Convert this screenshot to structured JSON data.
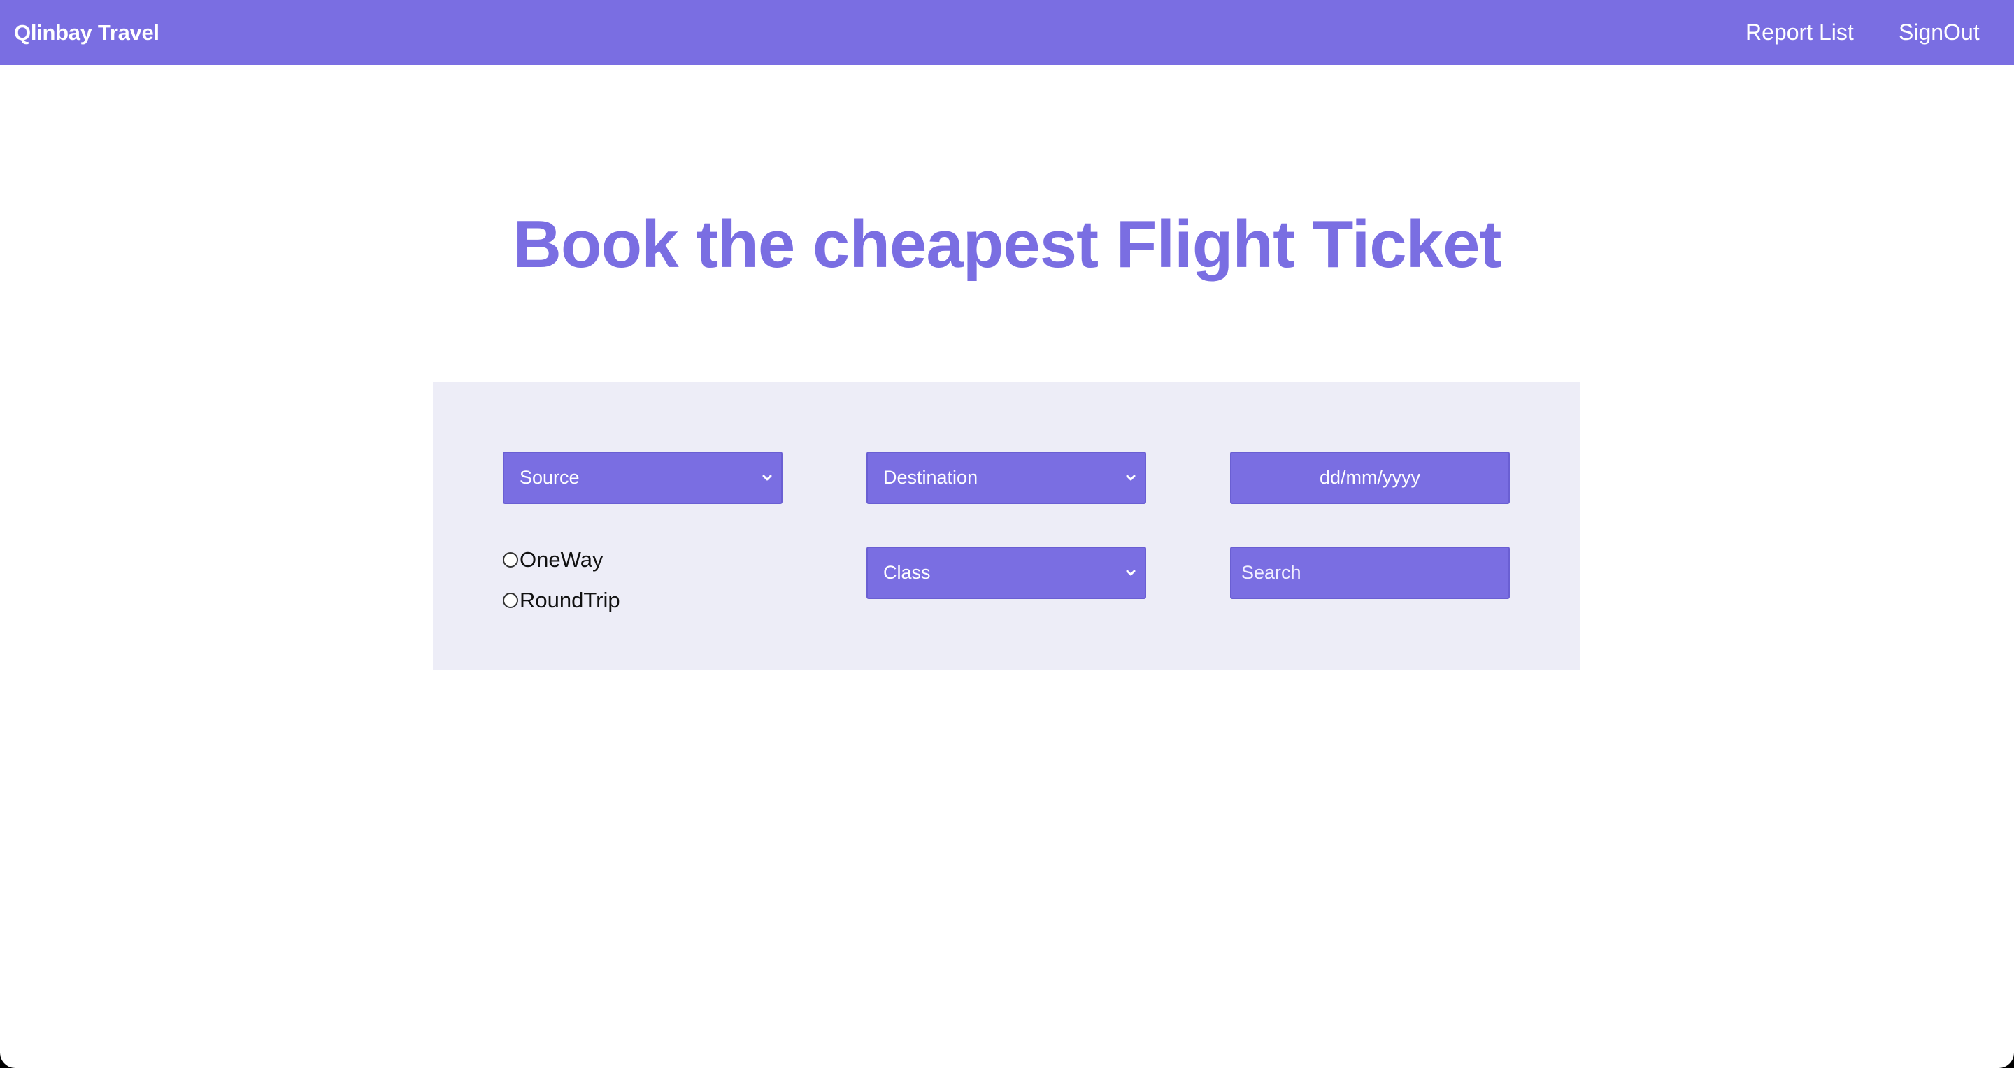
{
  "navbar": {
    "brand": "Qlinbay Travel",
    "links": {
      "report_list": "Report List",
      "sign_out": "SignOut"
    }
  },
  "hero": {
    "title": "Book the cheapest Flight Ticket"
  },
  "form": {
    "source": {
      "value": "Source"
    },
    "destination": {
      "value": "Destination"
    },
    "date": {
      "placeholder": "dd/mm/yyyy"
    },
    "trip_type": {
      "options": [
        "OneWay",
        "RoundTrip"
      ],
      "selected": null
    },
    "class": {
      "value": "Class"
    },
    "search": {
      "placeholder": "Search"
    }
  },
  "colors": {
    "accent": "#7a6ee2",
    "panel_background": "#ededf7",
    "page_background": "#ffffff"
  },
  "icons": {
    "select_arrow": "chevron-down-icon",
    "radio": "radio-unchecked-icon"
  }
}
